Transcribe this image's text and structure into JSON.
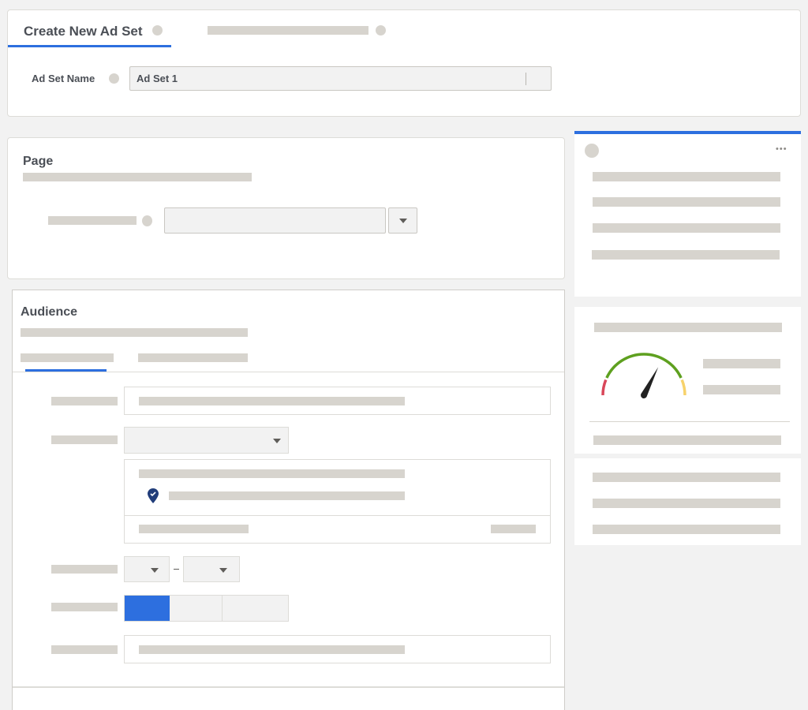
{
  "header": {
    "tab_active_label": "Create New Ad Set",
    "field_label": "Ad Set Name",
    "field_value": "Ad Set 1"
  },
  "page_section": {
    "title": "Page"
  },
  "audience_section": {
    "title": "Audience"
  },
  "gauge": {
    "needle_value_percent": 65,
    "segments": [
      {
        "name": "low",
        "color": "#d9475a"
      },
      {
        "name": "good",
        "color": "#5ea01f"
      },
      {
        "name": "high",
        "color": "#f7d26b"
      }
    ]
  },
  "colors": {
    "accent": "#2d6fdf",
    "placeholder": "#d7d4ce",
    "location_pin": "#213d7a"
  },
  "more_menu": "•••"
}
